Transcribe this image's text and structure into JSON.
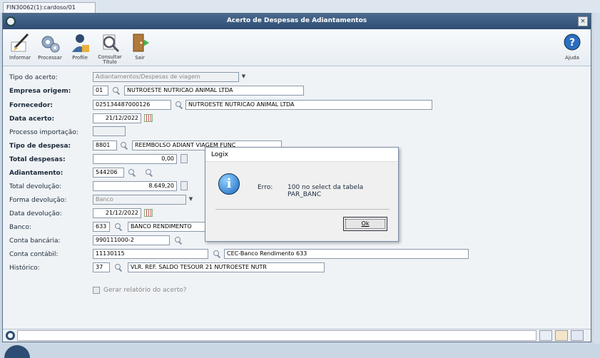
{
  "tab": {
    "label": "FIN30062(1):cardoso/01"
  },
  "window": {
    "title": "Acerto de Despesas de Adiantamentos"
  },
  "toolbar": {
    "informar": "Informar",
    "processar": "Processar",
    "profile": "Profile",
    "consultar": "Consultar",
    "titulo": "Título",
    "sair": "Sair",
    "ajuda": "Ajuda"
  },
  "form": {
    "tipo_acerto": {
      "label": "Tipo do acerto:",
      "value": "Adiantamentos/Despesas de viagem"
    },
    "empresa": {
      "label": "Empresa origem:",
      "code": "01",
      "name": "NUTROESTE NUTRICAO ANIMAL LTDA"
    },
    "fornecedor": {
      "label": "Fornecedor:",
      "code": "025134487000126",
      "name": "NUTROESTE NUTRICAO ANIMAL LTDA"
    },
    "data_acerto": {
      "label": "Data acerto:",
      "value": "21/12/2022"
    },
    "processo": {
      "label": "Processo importação:",
      "value": ""
    },
    "tipo_despesa": {
      "label": "Tipo de despesa:",
      "code": "8801",
      "name": "REEMBOLSO ADIANT VIAGEM FUNC"
    },
    "total_despesas": {
      "label": "Total despesas:",
      "value": "0,00"
    },
    "adiantamento": {
      "label": "Adiantamento:",
      "value": "544206"
    },
    "total_devolucao": {
      "label": "Total devolução:",
      "value": "8.649,20"
    },
    "forma_devolucao": {
      "label": "Forma devolução:",
      "value": "Banco"
    },
    "data_devolucao": {
      "label": "Data devolução:",
      "value": "21/12/2022"
    },
    "banco": {
      "label": "Banco:",
      "code": "633",
      "name": "BANCO RENDIMENTO"
    },
    "conta_bancaria": {
      "label": "Conta bancária:",
      "value": "990111000-2"
    },
    "conta_contabil": {
      "label": "Conta contábil:",
      "code": "11130115",
      "name": "CEC-Banco Rendimento 633"
    },
    "historico": {
      "label": "Histórico:",
      "code": "37",
      "name": "VLR. REF. SALDO TESOUR 21 NUTROESTE NUTR"
    },
    "gerar_relatorio": {
      "label": "Gerar relatório do acerto?",
      "checked": false
    }
  },
  "dialog": {
    "title": "Logix",
    "label": "Erro:",
    "message": "100 no select da tabela PAR_BANC",
    "ok": "Ok"
  }
}
